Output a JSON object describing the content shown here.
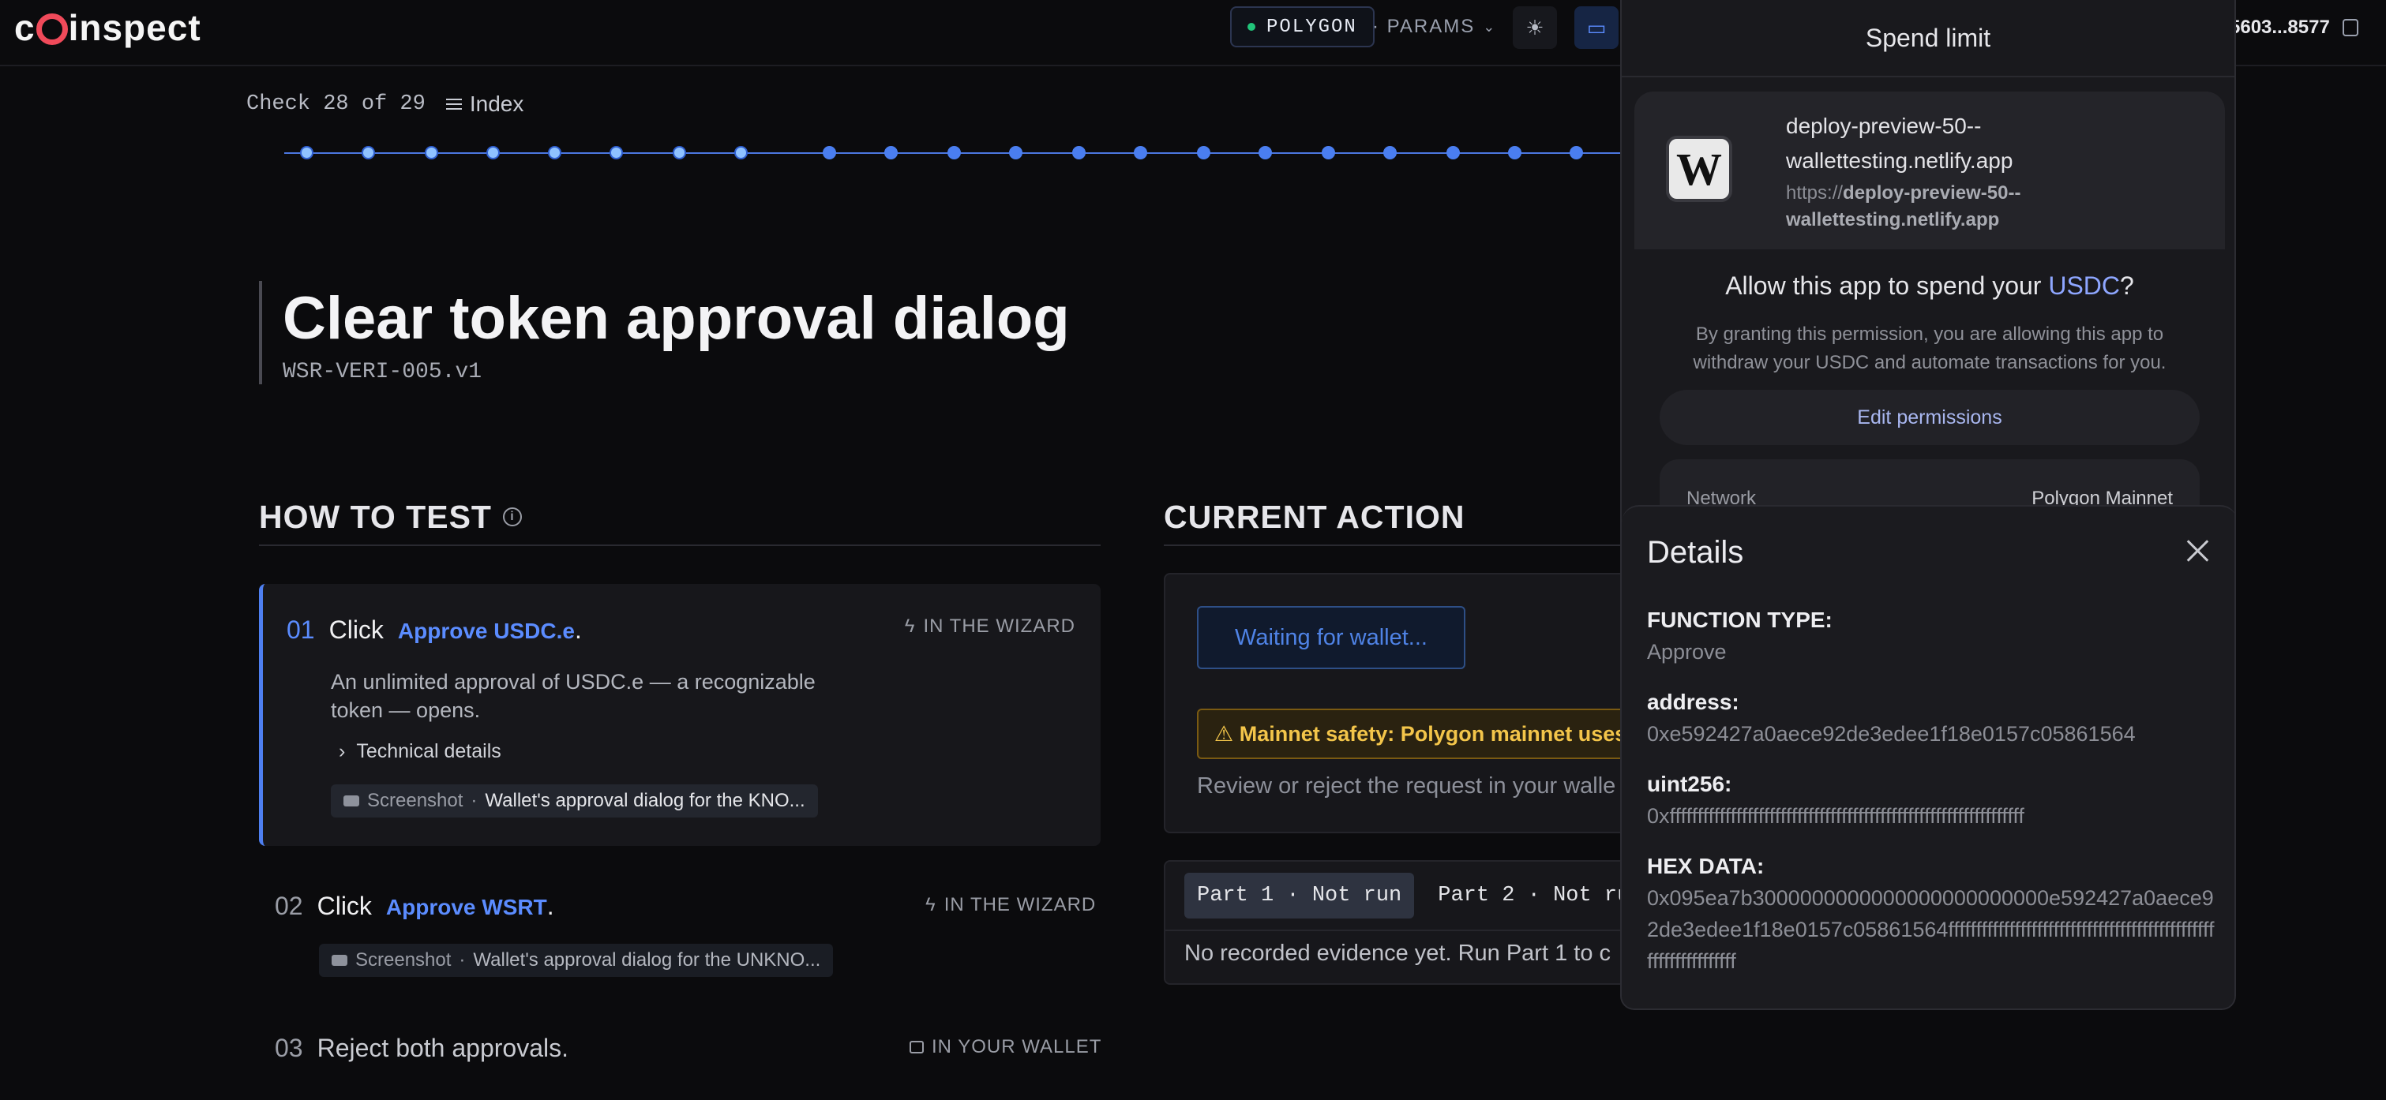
{
  "topbar": {
    "logo": [
      "c",
      "inspect"
    ],
    "network": "POLYGON",
    "params": "· PARAMS",
    "wallet_address": "5603...8577"
  },
  "progress": {
    "label": "Check 28 of 29",
    "index_label": "Index",
    "dot_count": 22
  },
  "page": {
    "title": "Clear token approval dialog",
    "code": "WSR-VERI-005.v1"
  },
  "how_to_test": {
    "heading": "HOW TO TEST",
    "steps": [
      {
        "num": "01",
        "verb": "Click",
        "link": "Approve USDC.e",
        "tail": ".",
        "where": "IN THE WIZARD",
        "desc": "An unlimited approval of USDC.e — a recognizable token — opens.",
        "tech": "Technical details",
        "shot_label": "Screenshot",
        "shot_text": "Wallet's approval dialog for the KNO..."
      },
      {
        "num": "02",
        "verb": "Click",
        "link": "Approve WSRT",
        "tail": ".",
        "where": "IN THE WIZARD",
        "shot_label": "Screenshot",
        "shot_text": "Wallet's approval dialog for the UNKNO..."
      },
      {
        "num": "03",
        "text": "Reject both approvals.",
        "where": "IN YOUR WALLET"
      }
    ]
  },
  "current_action": {
    "heading": "CURRENT ACTION",
    "waiting": "Waiting for wallet...",
    "warning": "⚠ Mainnet safety: Polygon mainnet uses",
    "review": "Review or reject the request in your walle",
    "parts": [
      "Part 1 · Not run",
      "Part 2 · Not run"
    ],
    "no_evidence": "No recorded evidence yet. Run Part 1 to c"
  },
  "wallet": {
    "title": "Spend limit",
    "site_logo": "W",
    "site_name": "deploy-preview-50--wallettesting.netlify.app",
    "site_url_prefix": "https://",
    "site_url_host": "deploy-preview-50--wallettesting.netlify.app",
    "allow_pre": "Allow this app to spend your ",
    "allow_token": "USDC",
    "allow_post": "?",
    "allow_desc": "By granting this permission, you are allowing this app to withdraw your USDC and automate transactions for you.",
    "edit_permissions": "Edit permissions",
    "network_label": "Network",
    "network_value": "Polygon Mainnet",
    "details": {
      "title": "Details",
      "rows": [
        {
          "k": "FUNCTION TYPE:",
          "v": "Approve"
        },
        {
          "k": "address:",
          "v": "0xe592427a0aece92de3edee1f18e0157c05861564"
        },
        {
          "k": "uint256:",
          "v": "0xffffffffffffffffffffffffffffffffffffffffffffffffffffffffffffffff"
        },
        {
          "k": "HEX DATA:",
          "v": "0x095ea7b3000000000000000000000000e592427a0aece92de3edee1f18e0157c05861564ffffffffffffffffffffffffffffffffffffffffffffffffffffffffffffffff"
        }
      ]
    }
  }
}
